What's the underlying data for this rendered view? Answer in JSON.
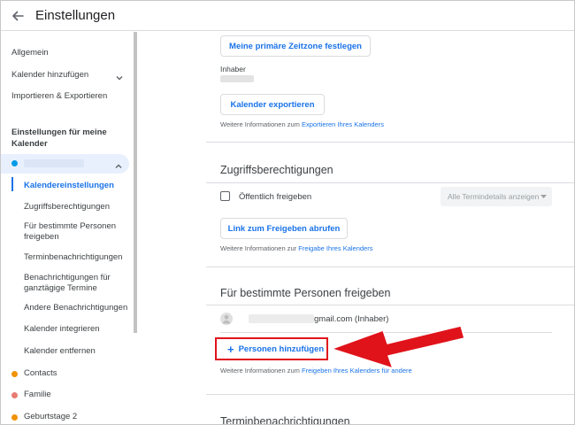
{
  "header": {
    "title": "Einstellungen"
  },
  "sidebar": {
    "items": [
      {
        "label": "Allgemein"
      },
      {
        "label": "Kalender hinzufügen"
      },
      {
        "label": "Importieren & Exportieren"
      }
    ],
    "section_title": "Einstellungen für meine Kalender",
    "sub_items": [
      {
        "label": "Kalendereinstellungen",
        "active": true
      },
      {
        "label": "Zugriffsberechtigungen"
      },
      {
        "label": "Für bestimmte Personen freigeben"
      },
      {
        "label": "Terminbenachrichtigungen"
      },
      {
        "label": "Benachrichtigungen für ganztägige Termine"
      },
      {
        "label": "Andere Benachrichtigungen"
      },
      {
        "label": "Kalender integrieren"
      },
      {
        "label": "Kalender entfernen"
      }
    ],
    "other_calendars": [
      {
        "label": "Contacts",
        "color": "#f09300"
      },
      {
        "label": "Familie",
        "color": "#e67c73"
      },
      {
        "label": "Geburtstage 2",
        "color": "#f09300"
      }
    ],
    "selected_calendar_color": "#039be5"
  },
  "main": {
    "timezone_button": "Meine primäre Zeitzone festlegen",
    "owner_label": "Inhaber",
    "export_button": "Kalender exportieren",
    "export_info_prefix": "Weitere Informationen zum ",
    "export_info_link": "Exportieren Ihres Kalenders",
    "access_title": "Zugriffsberechtigungen",
    "public_label": "Öffentlich freigeben",
    "details_select": "Alle Termindetails anzeigen",
    "share_link_button": "Link zum Freigeben abrufen",
    "share_info_prefix": "Weitere Informationen zur ",
    "share_info_link": "Freigabe Ihres Kalenders",
    "specific_title": "Für bestimmte Personen freigeben",
    "owner_email": "gmail.com (Inhaber)",
    "add_people_button": "Personen hinzufügen",
    "people_info_prefix": "Weitere Informationen zum ",
    "people_info_link": "Freigeben Ihres Kalenders für andere",
    "notifications_title": "Terminbenachrichtigungen"
  },
  "colors": {
    "accent": "#1a73e8",
    "highlight_box": "#e0131b",
    "arrow": "#e0131b"
  }
}
